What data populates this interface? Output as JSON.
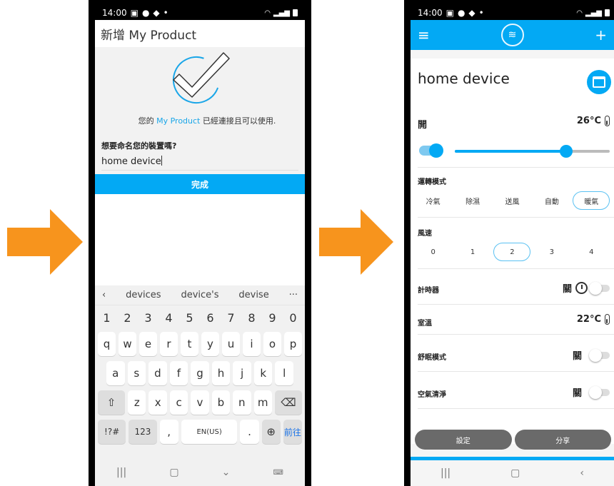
{
  "colors": {
    "accent": "#03a9f4",
    "arrow": "#f7941d"
  },
  "phone_a": {
    "status_time": "14:00",
    "title": "新增 My Product",
    "msg_pre": "您的 ",
    "msg_product": "My Product",
    "msg_post": " 已經連接且可以使用.",
    "question": "想要命名您的裝置嗎?",
    "input_value": "home device",
    "done_label": "完成",
    "keyboard": {
      "suggestions": [
        "devices",
        "device's",
        "devise"
      ],
      "num_row": [
        "1",
        "2",
        "3",
        "4",
        "5",
        "6",
        "7",
        "8",
        "9",
        "0"
      ],
      "row_q": [
        "q",
        "w",
        "e",
        "r",
        "t",
        "y",
        "u",
        "i",
        "o",
        "p"
      ],
      "row_a": [
        "a",
        "s",
        "d",
        "f",
        "g",
        "h",
        "j",
        "k",
        "l"
      ],
      "row_z": [
        "z",
        "x",
        "c",
        "v",
        "b",
        "n",
        "m"
      ],
      "sym_label": "!?#",
      "num_label": "123",
      "comma": ",",
      "space_label": "EN(US)",
      "period": ".",
      "go_label": "前往"
    }
  },
  "phone_b": {
    "status_time": "14:00",
    "device_name": "home device",
    "power_label": "開",
    "set_temp": "26°C",
    "temp_level_pct": 72,
    "mode_label": "運轉模式",
    "modes": [
      "冷氣",
      "除濕",
      "送風",
      "自動",
      "暖氣"
    ],
    "mode_selected": "暖氣",
    "fan_label": "風速",
    "fan_speeds": [
      "0",
      "1",
      "2",
      "3",
      "4"
    ],
    "fan_selected": "2",
    "timer_label": "計時器",
    "timer_state": "關",
    "room_temp_label": "室溫",
    "room_temp": "22°C",
    "sleep_label": "舒眠模式",
    "sleep_state": "關",
    "purify_label": "空氣清淨",
    "purify_state": "關",
    "settings_label": "設定",
    "share_label": "分享"
  }
}
